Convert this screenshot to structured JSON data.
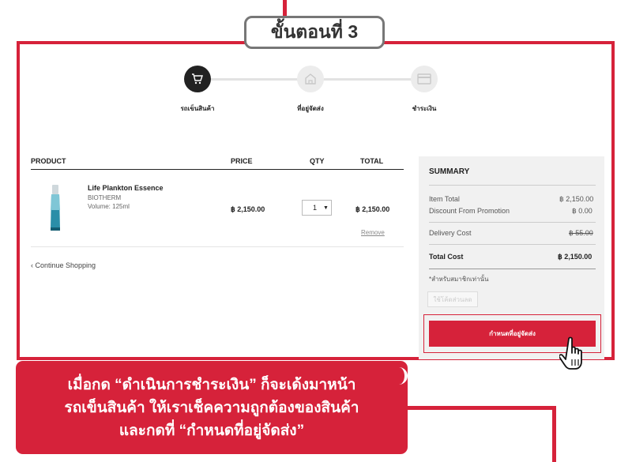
{
  "step_badge": "ขั้นตอนที่ 3",
  "steps": [
    {
      "label": "รถเข็นสินค้า",
      "icon": "cart-icon",
      "active": true
    },
    {
      "label": "ที่อยู่จัดส่ง",
      "icon": "home-icon",
      "active": false
    },
    {
      "label": "ชำระเงิน",
      "icon": "card-icon",
      "active": false
    }
  ],
  "table": {
    "headers": {
      "product": "PRODUCT",
      "price": "PRICE",
      "qty": "QTY",
      "total": "TOTAL"
    },
    "item": {
      "name": "Life Plankton Essence",
      "brand": "BIOTHERM",
      "volume": "Volume: 125ml",
      "price": "฿ 2,150.00",
      "qty": "1",
      "total": "฿ 2,150.00",
      "remove": "Remove"
    }
  },
  "continue_shopping": "Continue Shopping",
  "summary": {
    "title": "SUMMARY",
    "item_total_label": "Item Total",
    "item_total_value": "฿ 2,150.00",
    "discount_label": "Discount From Promotion",
    "discount_value": "฿ 0.00",
    "delivery_label": "Delivery Cost",
    "delivery_value": "฿ 55.00",
    "total_label": "Total Cost",
    "total_value": "฿ 2,150.00",
    "member_note": "*สำหรับสมาชิกเท่านั้น",
    "coupon_button": "ใช้โค้ดส่วนลด",
    "checkout_button": "กำหนดที่อยู่จัดส่ง"
  },
  "callout": {
    "line1": "เมื่อกด “ดำเนินการชำระเงิน” ก็จะเด้งมาหน้า",
    "line2": "รถเข็นสินค้า ให้เราเช็คความถูกต้องของสินค้า",
    "line3": "และกดที่ “กำหนดที่อยู่จัดส่ง”"
  },
  "colors": {
    "accent": "#d6223a",
    "summary_bg": "#f1f1f1"
  }
}
